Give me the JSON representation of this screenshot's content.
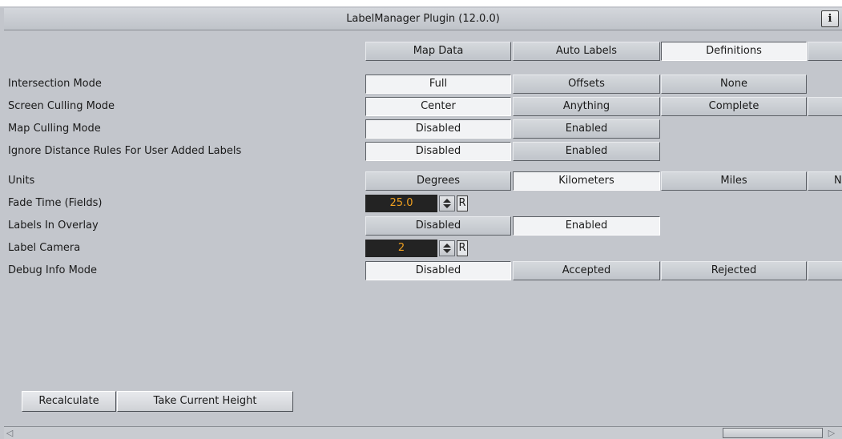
{
  "header": {
    "title": "LabelManager Plugin (12.0.0)",
    "info_label": "i"
  },
  "tabs": [
    {
      "label": "Map Data",
      "selected": false
    },
    {
      "label": "Auto Labels",
      "selected": false
    },
    {
      "label": "Definitions",
      "selected": true
    },
    {
      "label": "",
      "selected": false
    }
  ],
  "rows": {
    "intersection_mode": {
      "label": "Intersection Mode",
      "options": [
        "Full",
        "Offsets",
        "None"
      ],
      "selected": "Full"
    },
    "screen_culling_mode": {
      "label": "Screen Culling Mode",
      "options": [
        "Center",
        "Anything",
        "Complete",
        ""
      ],
      "selected": "Center"
    },
    "map_culling_mode": {
      "label": "Map Culling Mode",
      "options": [
        "Disabled",
        "Enabled"
      ],
      "selected": "Disabled"
    },
    "ignore_distance_rules": {
      "label": "Ignore Distance Rules For User Added Labels",
      "options": [
        "Disabled",
        "Enabled"
      ],
      "selected": "Disabled"
    },
    "units": {
      "label": "Units",
      "options": [
        "Degrees",
        "Kilometers",
        "Miles",
        "N"
      ],
      "selected": "Kilometers"
    },
    "fade_time": {
      "label": "Fade Time (Fields)",
      "value": "25.0",
      "reset_label": "R"
    },
    "labels_in_overlay": {
      "label": "Labels In Overlay",
      "options": [
        "Disabled",
        "Enabled"
      ],
      "selected": "Enabled"
    },
    "label_camera": {
      "label": "Label Camera",
      "value": "2",
      "reset_label": "R"
    },
    "debug_info_mode": {
      "label": "Debug Info Mode",
      "options": [
        "Disabled",
        "Accepted",
        "Rejected",
        ""
      ],
      "selected": "Disabled"
    }
  },
  "actions": {
    "recalculate_label": "Recalculate",
    "take_current_height_label": "Take Current Height"
  },
  "colors": {
    "panel_bg": "#c3c6cc",
    "number_field_bg": "#232323",
    "number_field_text": "#f0a020",
    "selected_button_bg": "#f2f3f5"
  }
}
